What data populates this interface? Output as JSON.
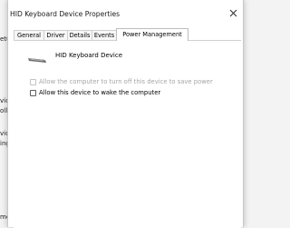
{
  "background": {
    "fragments": [
      "etup",
      "vice",
      "olle",
      "vice",
      "ing",
      "me"
    ]
  },
  "dialog": {
    "title": "HID Keyboard Device Properties",
    "close_glyph": "✕",
    "tabs": [
      {
        "label": "General",
        "active": false
      },
      {
        "label": "Driver",
        "active": false
      },
      {
        "label": "Details",
        "active": false
      },
      {
        "label": "Events",
        "active": false
      },
      {
        "label": "Power Management",
        "active": true
      }
    ],
    "device": {
      "icon": "keyboard-icon",
      "name": "HID Keyboard Device"
    },
    "options": [
      {
        "label": "Allow the computer to turn off this device to save power",
        "checked": false,
        "enabled": false
      },
      {
        "label": "Allow this device to wake the computer",
        "checked": false,
        "enabled": true
      }
    ]
  },
  "colors": {
    "dialog_bg": "#ffffff",
    "window_bg": "#f3f3f3",
    "disabled_text": "#a5a5a5"
  }
}
